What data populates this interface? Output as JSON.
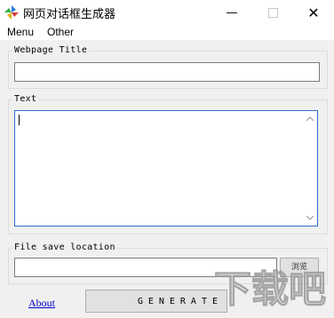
{
  "window": {
    "title": "网页对话框生成器",
    "minimize_symbol": "—",
    "close_symbol": "✕"
  },
  "menu": {
    "items": [
      "Menu",
      "Other"
    ]
  },
  "webpage_title": {
    "label": "Webpage Title",
    "value": ""
  },
  "text_section": {
    "label": "Text",
    "value": ""
  },
  "file_save": {
    "label": "File save location",
    "value": "",
    "browse_label": "浏览"
  },
  "footer": {
    "about_label": "About",
    "generate_label": "GENERATE"
  },
  "watermark": {
    "text": "下载吧"
  },
  "colors": {
    "window_bg": "#f0f0f0",
    "titlebar_bg": "#ffffff",
    "focus_border": "#2d6ecb",
    "link": "#0000cc"
  }
}
